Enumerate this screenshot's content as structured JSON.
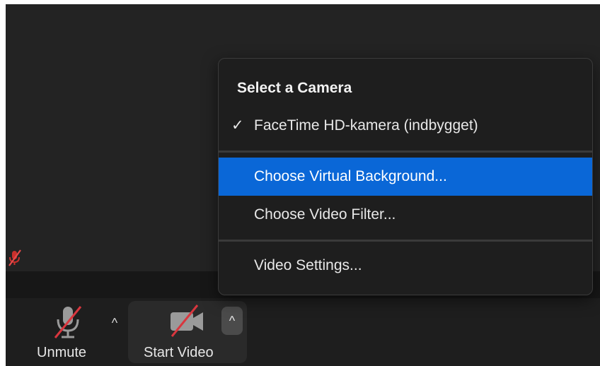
{
  "camera_menu": {
    "heading": "Select a Camera",
    "items": [
      {
        "label": "FaceTime HD-kamera (indbygget)",
        "checked": true,
        "highlighted": false
      },
      {
        "label": "Choose Virtual Background...",
        "checked": false,
        "highlighted": true
      },
      {
        "label": "Choose Video Filter...",
        "checked": false,
        "highlighted": false
      },
      {
        "label": "Video Settings...",
        "checked": false,
        "highlighted": false
      }
    ],
    "checkmark": "✓"
  },
  "toolbar": {
    "unmute_label": "Unmute",
    "start_video_label": "Start Video",
    "caret": "^"
  },
  "colors": {
    "highlight": "#0a67d7",
    "mute_slash": "#d9363e",
    "menu_background": "#1e1e1e",
    "toolbar_background": "#1e1e1e"
  },
  "icons": {
    "participant": "muted-mic-icon",
    "audio": "muted-microphone-icon",
    "video": "video-off-camera-icon",
    "caret": "chevron-up-icon"
  }
}
